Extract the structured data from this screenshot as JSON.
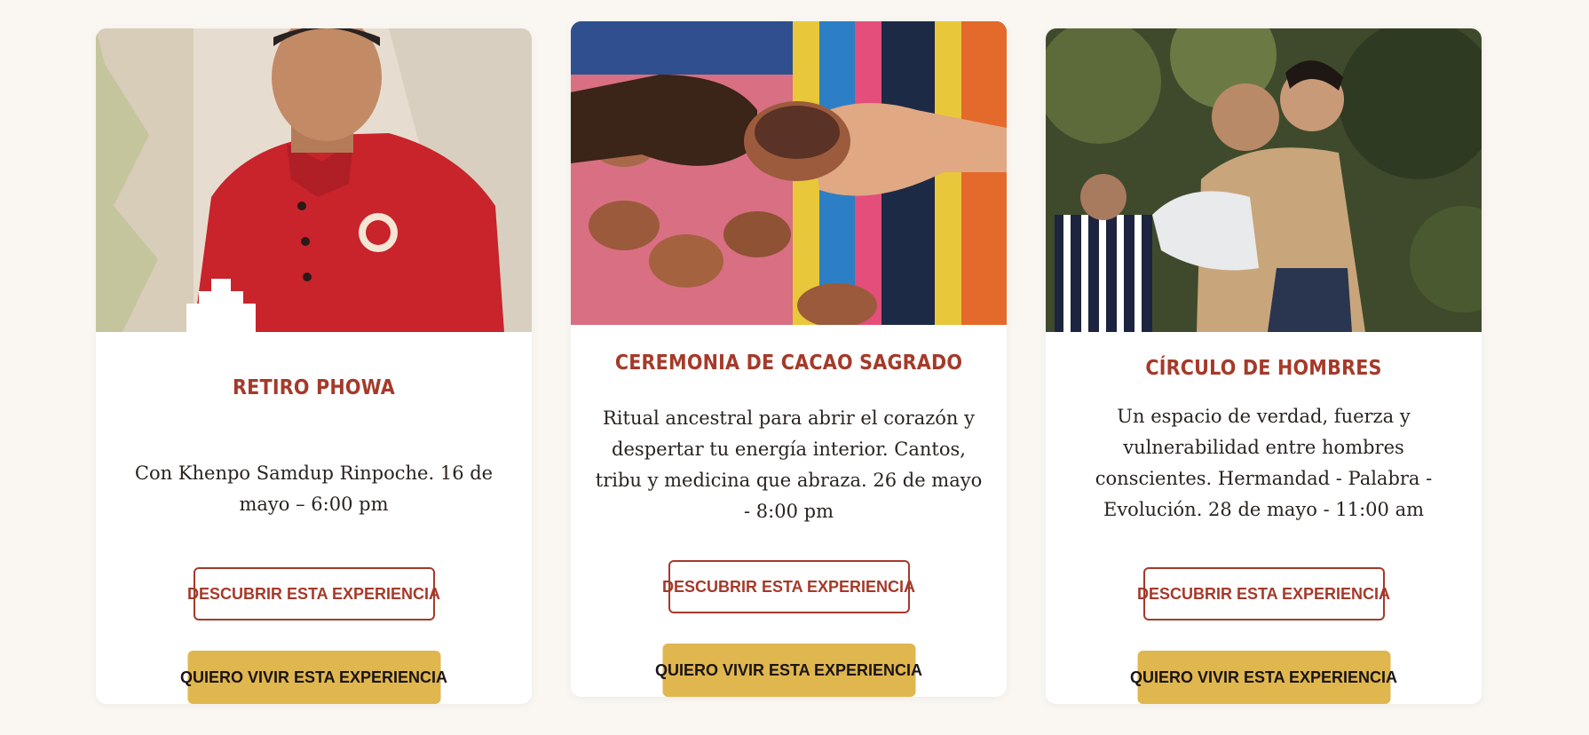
{
  "colors": {
    "title": "#a53a2a",
    "primary_button": "#e0b64f",
    "outline_button": "#a53a2a",
    "background": "#faf7f3"
  },
  "cards": [
    {
      "title": "RETIRO PHOWA",
      "description": "Con Khenpo Samdup Rinpoche. 16 de mayo – 6:00 pm",
      "discover_label": "Descubrir esta experiencia",
      "join_label": "Quiero vivir esta experiencia"
    },
    {
      "title": "CEREMONIA DE CACAO SAGRADO",
      "description": "Ritual ancestral para abrir el corazón y despertar tu energía interior. Cantos, tribu y medicina que abraza. 26 de mayo - 8:00 pm",
      "discover_label": "Descubrir esta experiencia",
      "join_label": "Quiero vivir esta experiencia"
    },
    {
      "title": "CÍRCULO DE HOMBRES",
      "description": "Un espacio de verdad, fuerza y vulnerabilidad entre hombres conscientes. Hermandad - Palabra - Evolución. 28 de mayo - 11:00 am",
      "discover_label": "Descubrir esta experiencia",
      "join_label": "Quiero vivir esta experiencia"
    }
  ]
}
